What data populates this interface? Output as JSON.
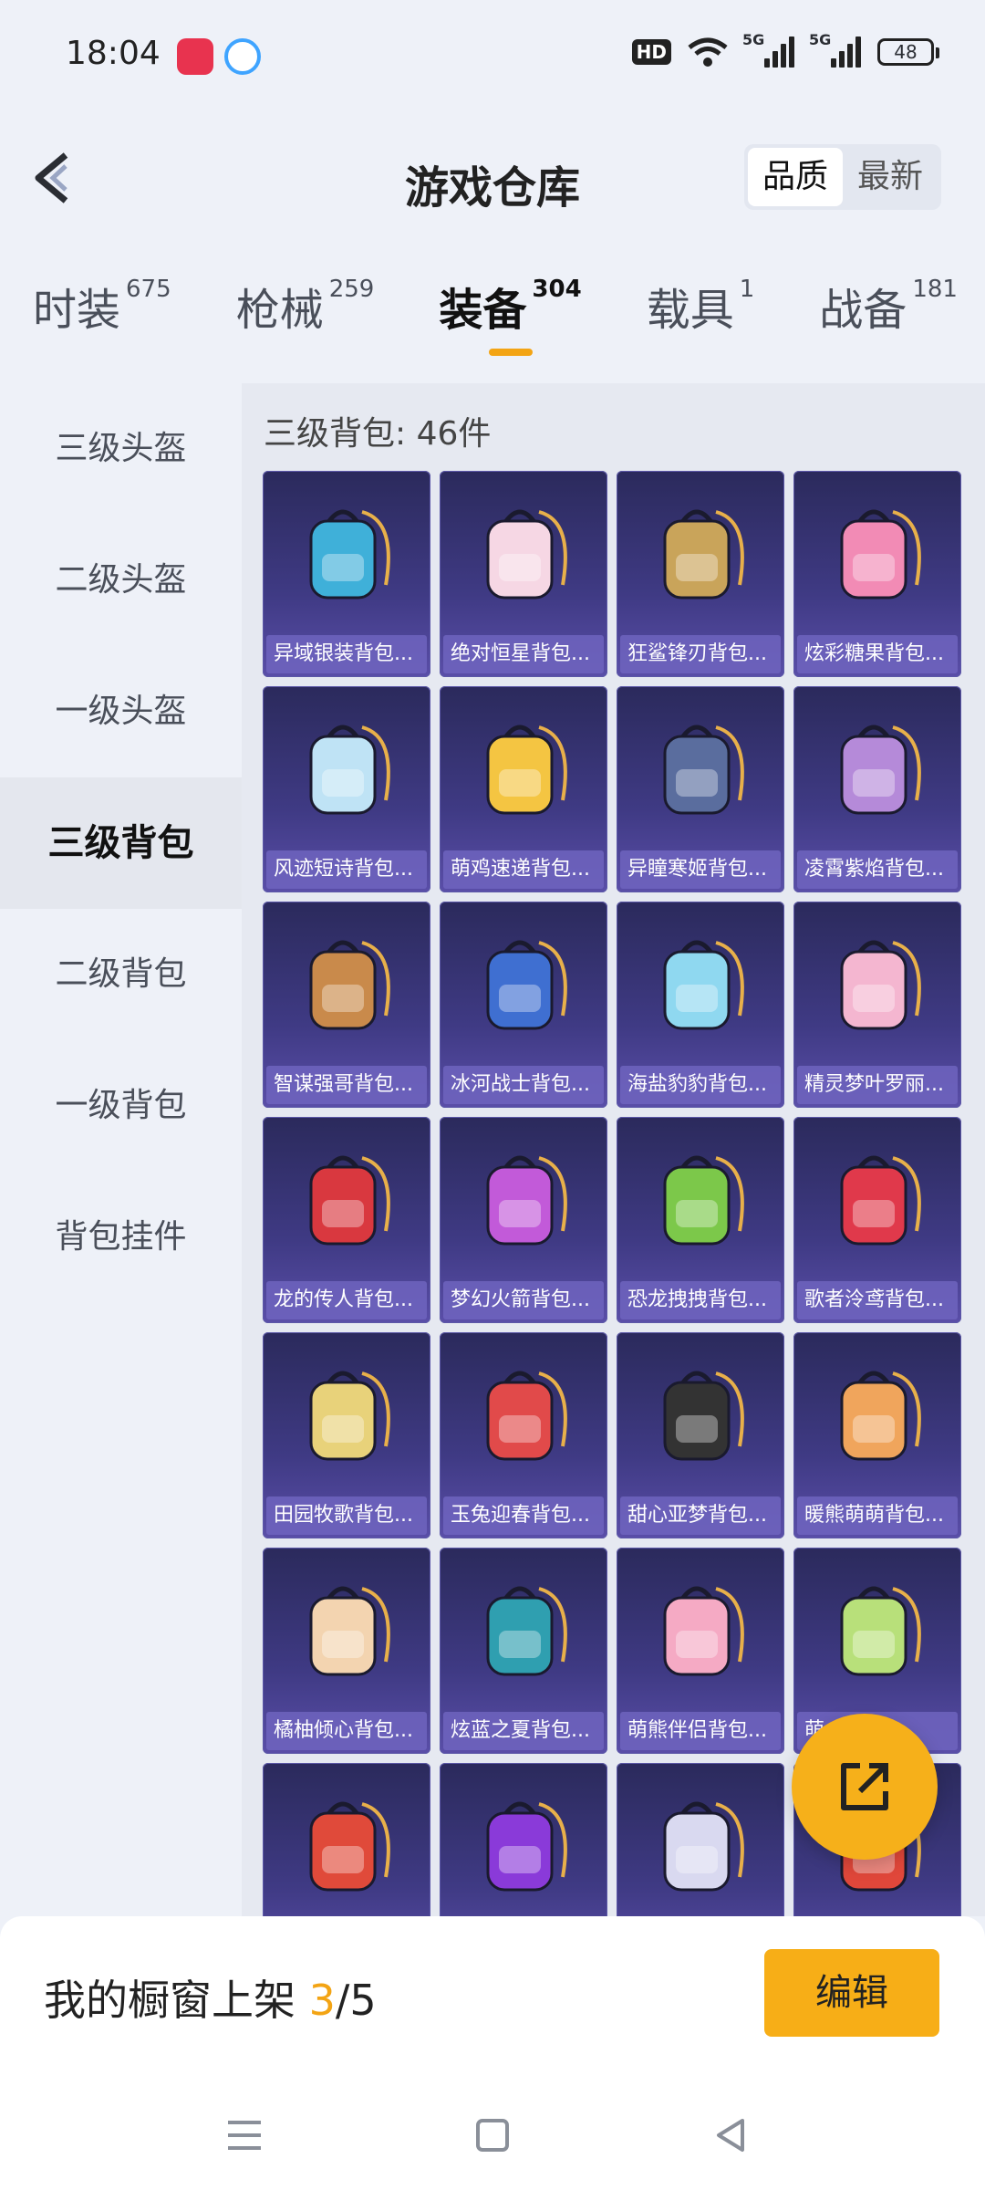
{
  "status_bar": {
    "time": "18:04",
    "battery": "48",
    "hd": "HD",
    "net1": "5G",
    "net2": "5G"
  },
  "header": {
    "title": "游戏仓库",
    "sort_options": [
      "品质",
      "最新"
    ]
  },
  "tabs": [
    {
      "label": "时装",
      "count": "675"
    },
    {
      "label": "枪械",
      "count": "259"
    },
    {
      "label": "装备",
      "count": "304"
    },
    {
      "label": "载具",
      "count": "1"
    },
    {
      "label": "战备",
      "count": "181"
    }
  ],
  "sidebar": [
    "三级头盔",
    "二级头盔",
    "一级头盔",
    "三级背包",
    "二级背包",
    "一级背包",
    "背包挂件"
  ],
  "section": {
    "title": "三级背包: 46件"
  },
  "items": [
    "异域银装背包...",
    "绝对恒星背包...",
    "狂鲨锋刃背包...",
    "炫彩糖果背包...",
    "风迹短诗背包...",
    "萌鸡速递背包...",
    "异瞳寒姬背包...",
    "凌霄紫焰背包...",
    "智谋强哥背包...",
    "冰河战士背包...",
    "海盐豹豹背包...",
    "精灵梦叶罗丽...",
    "龙的传人背包...",
    "梦幻火箭背包...",
    "恐龙拽拽背包...",
    "歌者泠鸢背包...",
    "田园牧歌背包...",
    "玉兔迎春背包...",
    "甜心亚梦背包...",
    "暖熊萌萌背包...",
    "橘柚倾心背包...",
    "炫蓝之夏背包...",
    "萌熊伴侣背包...",
    "萌...子背...",
    "",
    "",
    "",
    ""
  ],
  "bottom": {
    "shelf_label": "我的橱窗上架 ",
    "shelf_current": "3",
    "shelf_total": "/5",
    "edit_label": "编辑"
  },
  "colors": {
    "accent": "#f3a414",
    "card_bg": "#3f3a84",
    "page_bg": "#eef1f8"
  }
}
